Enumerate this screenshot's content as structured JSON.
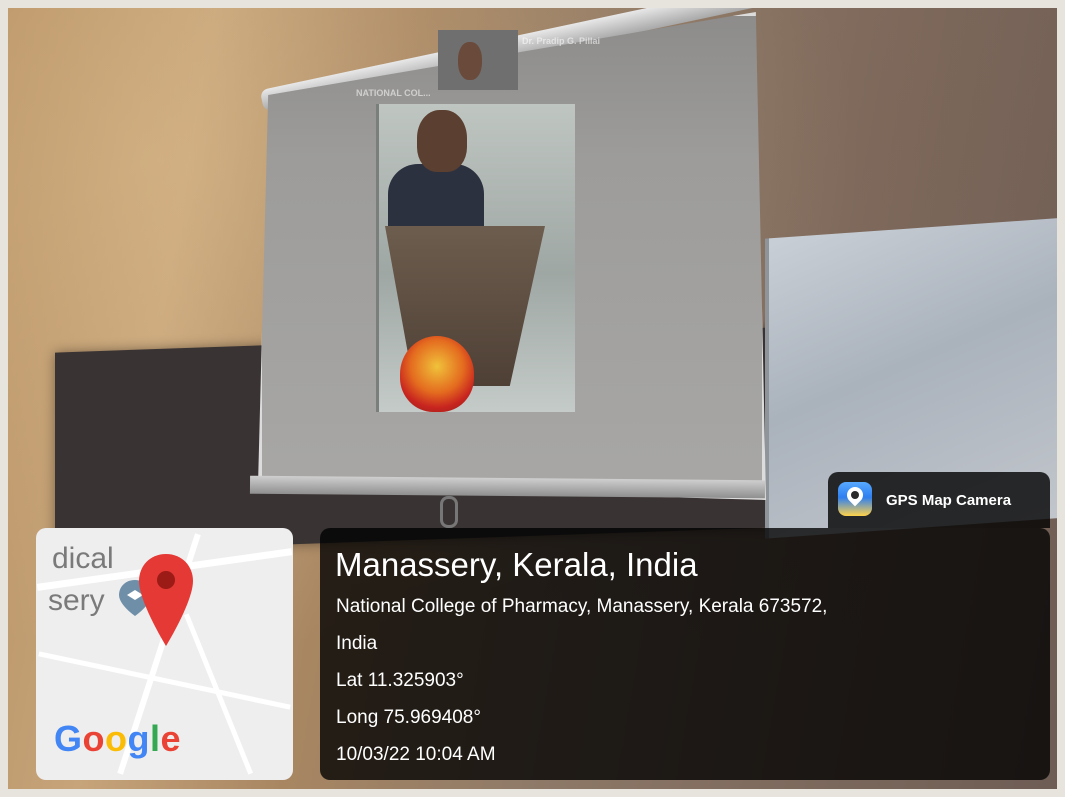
{
  "overlay": {
    "app_name": "GPS Map Camera",
    "location_title": "Manassery, Kerala, India",
    "address_line1": "National College of Pharmacy, Manassery, Kerala 673572,",
    "address_line2": "India",
    "latitude": "Lat 11.325903°",
    "longitude": "Long 75.969408°",
    "timestamp": "10/03/22 10:04 AM"
  },
  "map": {
    "label_line1": "dical",
    "label_line2": "sery",
    "logo_letters": [
      "G",
      "o",
      "o",
      "g",
      "l",
      "e"
    ],
    "logo_colors": [
      "#4285f4",
      "#ea4335",
      "#fbbc05",
      "#4285f4",
      "#34a853",
      "#ea4335"
    ],
    "pin_color": "#e53935",
    "secondary_pin_color": "#6f8fa8"
  },
  "screen": {
    "participant_label_left": "NATIONAL COL...",
    "participant_label_right": "Dr. Pradip G. Pillai"
  },
  "icons": {
    "map_pin": "map-pin-icon",
    "place_pin": "place-pin-icon",
    "app_icon": "gps-camera-icon"
  }
}
